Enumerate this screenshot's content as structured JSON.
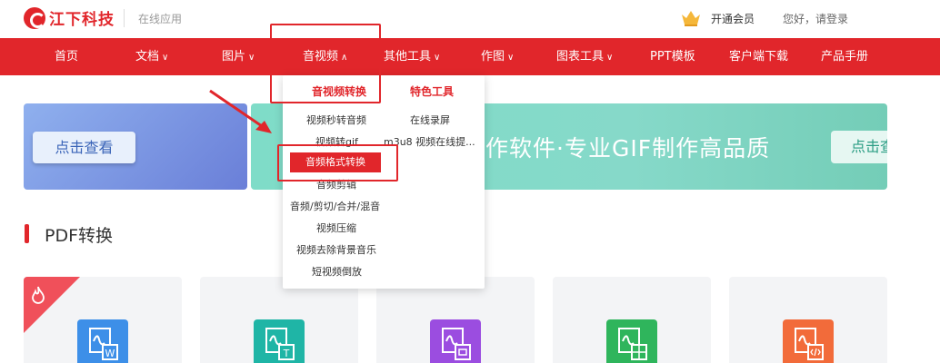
{
  "header": {
    "brand": "江下科技",
    "brand_sub": "在线应用",
    "vip_label": "开通会员",
    "greeting": "您好，请登录"
  },
  "nav": {
    "items": [
      {
        "label": "首页",
        "chevron": ""
      },
      {
        "label": "文档",
        "chevron": "∨"
      },
      {
        "label": "图片",
        "chevron": "∨"
      },
      {
        "label": "音视频",
        "chevron": "∧"
      },
      {
        "label": "其他工具",
        "chevron": "∨"
      },
      {
        "label": "作图",
        "chevron": "∨"
      },
      {
        "label": "图表工具",
        "chevron": "∨"
      },
      {
        "label": "PPT模板",
        "chevron": ""
      },
      {
        "label": "客户端下载",
        "chevron": ""
      },
      {
        "label": "产品手册",
        "chevron": ""
      }
    ]
  },
  "dropdown": {
    "col1_title": "音视频转换",
    "col2_title": "特色工具",
    "col1_items": [
      "视频秒转音频",
      "视频转gif",
      "音频格式转换",
      "音频剪辑",
      "音频/剪切/合并/混音",
      "视频压缩",
      "视频去除背景音乐",
      "短视频倒放"
    ],
    "col2_items": [
      "在线录屏",
      "m3u8 视频在线提..."
    ]
  },
  "banner": {
    "left_button": "点击查看",
    "slogan": "作软件·专业GIF制作高品质",
    "right_button": "点击查"
  },
  "section": {
    "title": "PDF转换"
  },
  "cards": [
    {
      "icon": "pdf-to-word-icon",
      "color": "#3d8fe8"
    },
    {
      "icon": "pdf-to-txt-icon",
      "color": "#1fb5a6"
    },
    {
      "icon": "pdf-to-ppt-icon",
      "color": "#9b4de0"
    },
    {
      "icon": "pdf-to-excel-icon",
      "color": "#2fb55c"
    },
    {
      "icon": "pdf-to-html-icon",
      "color": "#f26b3a"
    }
  ],
  "colors": {
    "brand_red": "#e1262b"
  }
}
